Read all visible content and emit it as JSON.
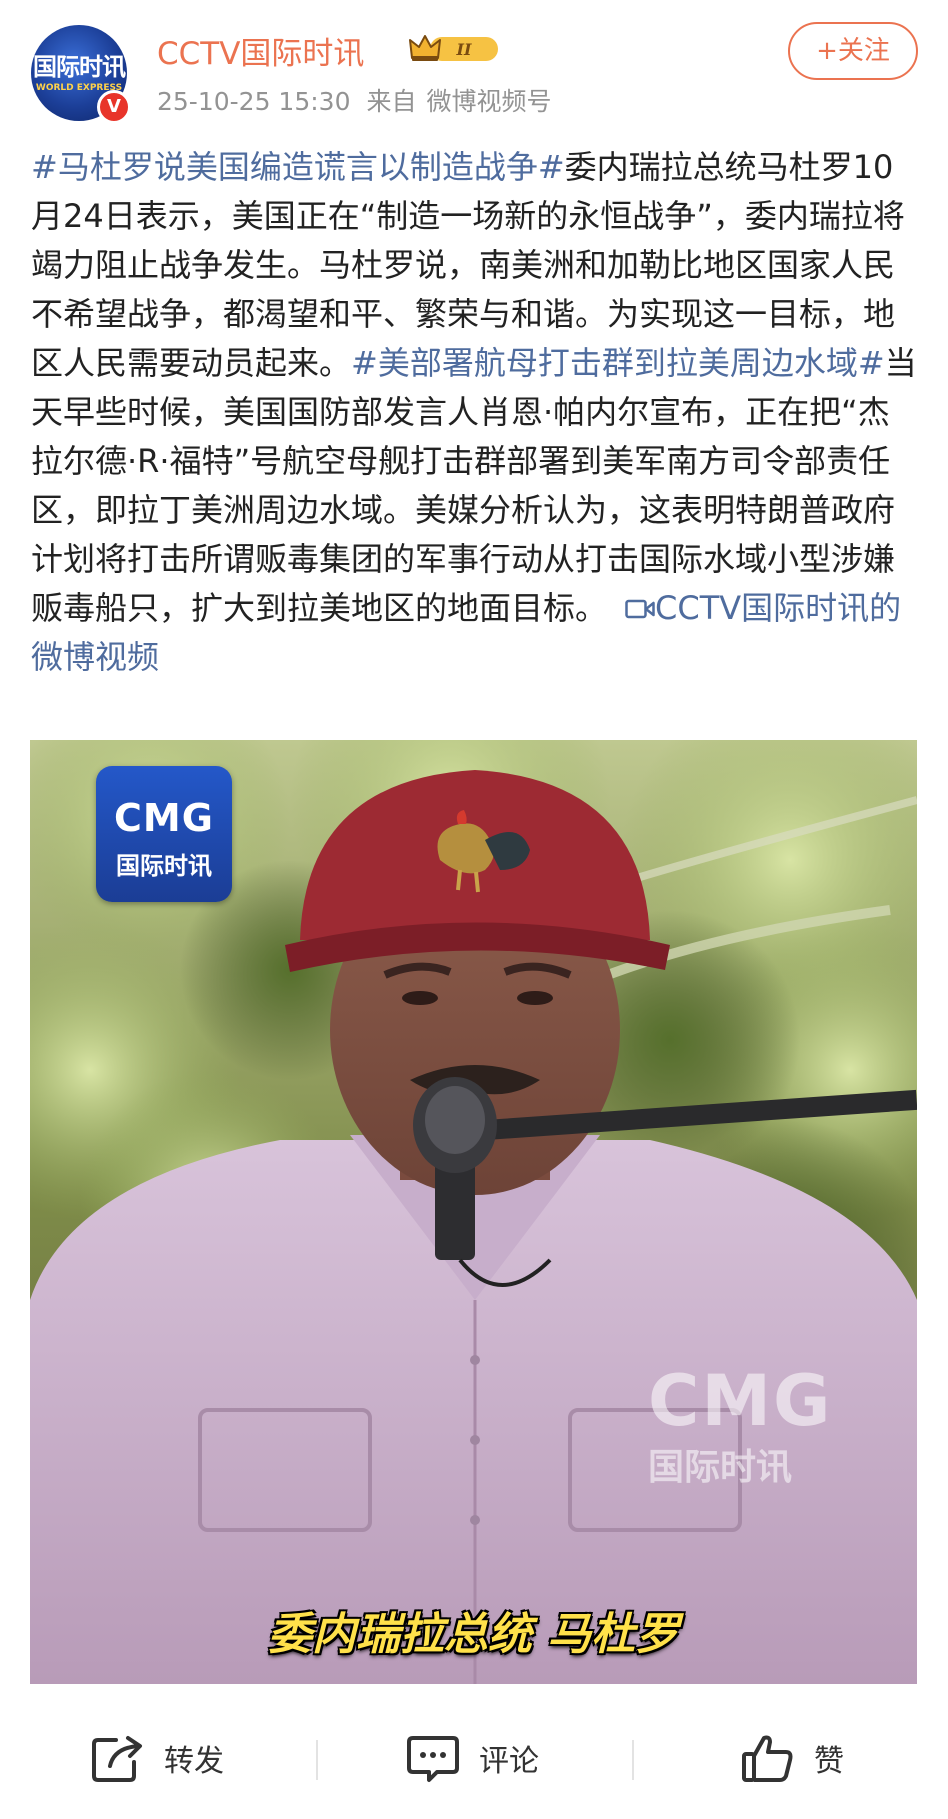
{
  "header": {
    "avatar_text": "国际时讯",
    "avatar_subtext": "WORLD EXPRESS",
    "verified_mark": "V",
    "username": "CCTV国际时讯",
    "member_level": "II",
    "timestamp": "25-10-25 15:30",
    "source_prefix": "来自",
    "source_name": "微博视频号",
    "follow_label": "+关注"
  },
  "post": {
    "segments": [
      {
        "type": "hashtag",
        "text": "#马杜罗说美国编造谎言以制造战争#"
      },
      {
        "type": "text",
        "text": "委内瑞拉总统马杜罗10月24日表示，美国正在“制造一场新的永恒战争”，委内瑞拉将竭力阻止战争发生。马杜罗说，南美洲和加勒比地区国家人民不希望战争，都渴望和平、繁荣与和谐。为实现这一目标，地区人民需要动员起来。"
      },
      {
        "type": "hashtag",
        "text": "#美部署航母打击群到拉美周边水域#"
      },
      {
        "type": "text",
        "text": "当天早些时候，美国国防部发言人肖恩·帕内尔宣布，正在把“杰拉尔德·R·福特”号航空母舰打击群部署到美军南方司令部责任区，即拉丁美洲周边水域。美媒分析认为，这表明特朗普政府计划将打击所谓贩毒集团的军事行动从打击国际水域小型涉嫌贩毒船只，扩大到拉美地区的地面目标。"
      }
    ],
    "video_link_text": "CCTV国际时讯的微博视频"
  },
  "video": {
    "logo_en": "CMG",
    "logo_cn": "国际时讯",
    "watermark_en": "CMG",
    "watermark_cn": "国际时讯",
    "caption": "委内瑞拉总统 马杜罗"
  },
  "actions": {
    "repost_label": "转发",
    "comment_label": "评论",
    "like_label": "赞"
  },
  "colors": {
    "accent_orange": "#eb7350",
    "link_blue": "#4f6c9e",
    "meta_gray": "#939393",
    "verified_red": "#e8342a",
    "caption_yellow": "#ffe14a"
  }
}
